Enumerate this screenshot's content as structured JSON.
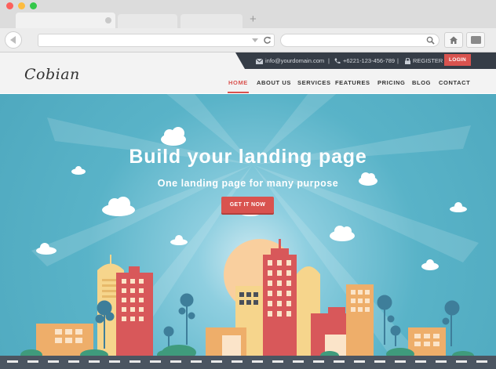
{
  "topbar": {
    "email": "info@yourdomain.com",
    "phone": "+6221-123-456-789",
    "register": "REGISTER",
    "login": "LOGIN",
    "separator": "|"
  },
  "logo": "Cobian",
  "nav": {
    "items": [
      {
        "label": "HOME",
        "active": true
      },
      {
        "label": "ABOUT US",
        "active": false
      },
      {
        "label": "SERVICES",
        "active": false
      },
      {
        "label": "FEATURES",
        "active": false
      },
      {
        "label": "PRICING",
        "active": false
      },
      {
        "label": "BLOG",
        "active": false
      },
      {
        "label": "CONTACT",
        "active": false
      }
    ]
  },
  "hero": {
    "title": "Build your landing page",
    "subtitle": "One landing page for many purpose",
    "cta": "GET IT NOW"
  },
  "browser": {
    "new_tab": "+"
  },
  "colors": {
    "accent": "#d9534f",
    "topbar": "#363d47",
    "sky": "#59b3c8",
    "road": "#4b5561"
  }
}
